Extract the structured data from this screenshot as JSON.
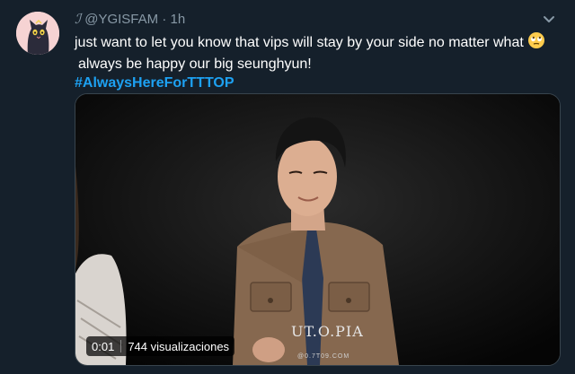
{
  "tweet": {
    "name_glyph": "ℐ",
    "handle": "@YGISFAM",
    "separator": "·",
    "time": "1h",
    "text_line1": "just want to let you know that vips will stay by your side no matter what",
    "text_line2": "always be happy our big seunghyun!",
    "hashtag": "#AlwaysHereForTTTOP",
    "emoji_icon": "rolling-eyes-emoji",
    "menu_icon": "chevron-down-icon"
  },
  "media": {
    "time": "0:01",
    "views": "744 visualizaciones",
    "watermark": "UT.O.PIA",
    "watermark_sub": "@0.7T09.COM"
  }
}
